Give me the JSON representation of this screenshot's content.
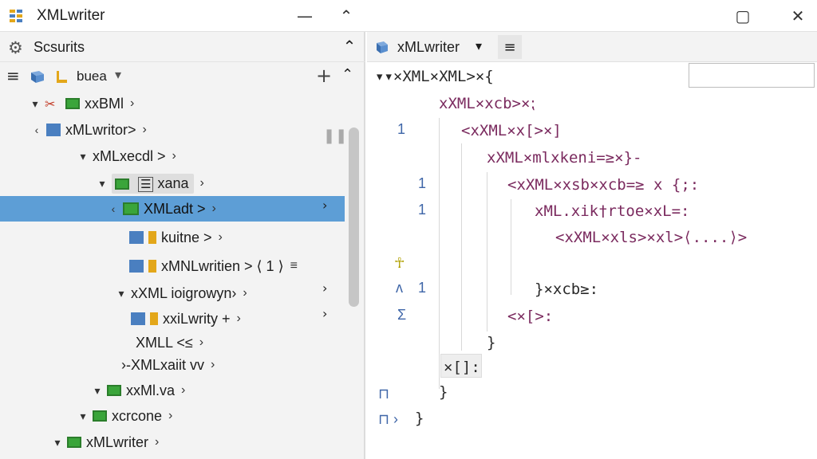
{
  "window": {
    "title": "XMLwriter",
    "minimize_glyph": "⌃",
    "maximize_glyph": "▢",
    "close_glyph": "✕",
    "icons": {
      "app": "table-grid-icon",
      "minimize": "line-icon",
      "collapse": "chevron-up-icon",
      "restore": "restore-icon",
      "close": "close-icon"
    },
    "colors": {
      "accent": "#5d9ed6",
      "folder": "#3aa53a",
      "cube": "#4a7fc0",
      "package": "#e3a71a",
      "keyword": "#7b2b5f",
      "marker": "#c23b26"
    }
  },
  "left_panel": {
    "header": {
      "title": "Scsurits",
      "icon": "gear-icon",
      "collapse_glyph": "⌃"
    },
    "toolbar": {
      "menu_glyph": "≡",
      "label": "buea",
      "drop_glyph": "▾",
      "add_glyph": "+",
      "up_glyph": "⌃"
    },
    "tree": [
      {
        "label": "xxBMl",
        "arrow": "›",
        "twist": "▾"
      },
      {
        "label": "xMLwritor>",
        "arrow": "›",
        "twist": "‹"
      },
      {
        "label": "xMLxecdl >",
        "arrow": "›",
        "twist": "▾"
      },
      {
        "label": "xana",
        "arrow": "›",
        "twist": "▾"
      },
      {
        "label": "XMLadt >",
        "arrow": "›",
        "twist": "‹"
      },
      {
        "label": "kuitne >",
        "arrow": "›",
        "twist": ""
      },
      {
        "label": "xMNLwritien > ⟨ 1 ⟩",
        "arrow": "≡",
        "twist": ""
      },
      {
        "label": "xXML ioigrowyn›",
        "arrow": "›",
        "twist": "▾"
      },
      {
        "label": "xxiLwrity +",
        "arrow": "›",
        "twist": ""
      },
      {
        "label": "XMLL <≤",
        "arrow": "›",
        "twist": ""
      },
      {
        "label": "›-XMLxaiit vv",
        "arrow": "›",
        "twist": ""
      },
      {
        "label": "xxMl.va",
        "arrow": "›",
        "twist": "▾"
      },
      {
        "label": "xcrcone",
        "arrow": "›",
        "twist": "▾"
      },
      {
        "label": "xMLwriter",
        "arrow": "›",
        "twist": "▾"
      }
    ],
    "right_markers": [
      "›",
      "›",
      "›"
    ],
    "pause_glyph": "❚❚"
  },
  "editor": {
    "tab_title": "xMLwriter",
    "tab_drop": "▾",
    "tab_menu": "≡",
    "search_placeholder": "",
    "lines": [
      "▾▾×XML×XML>×{",
      "xXML×xcb>×⁏",
      "<xXML×x[>×]",
      "xXML×mlxkeni=≥×}-",
      "<xXML×xsb×xcb=≥ x {;:",
      "xML.xik†rtoe×xL=:",
      "<xXML×xls>×xl>⟨....⟩>",
      "}×xcb≥:",
      "<×[>:",
      "}",
      "×[]:",
      "}",
      "}"
    ],
    "gutter": [
      "1",
      "1",
      "1",
      "1"
    ],
    "gutter_marks": [
      "☥",
      "ʌ",
      "Σ",
      "⊓",
      "⊓ ›"
    ]
  }
}
